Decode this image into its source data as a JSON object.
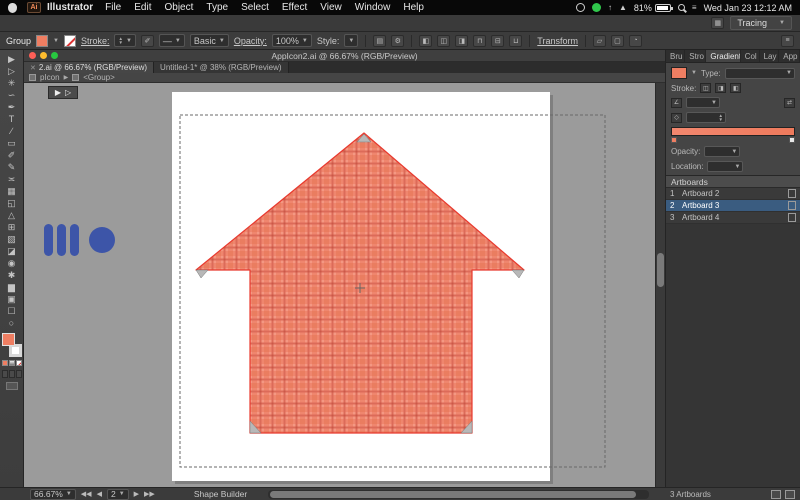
{
  "menubar": {
    "app_name": "Illustrator",
    "items": [
      "File",
      "Edit",
      "Object",
      "Type",
      "Select",
      "Effect",
      "View",
      "Window",
      "Help"
    ],
    "battery": "81%",
    "clock": "Wed Jan 23 12:12 AM"
  },
  "appbar": {
    "workspace": "Tracing"
  },
  "controlbar": {
    "selection_label": "Group",
    "stroke_label": "Stroke:",
    "brush_value": "Basic",
    "opacity_label": "Opacity:",
    "opacity_value": "100%",
    "style_label": "Style:",
    "transform_label": "Transform"
  },
  "window_title": "AppIcon2.ai @ 66.67% (RGB/Preview)",
  "tabs": [
    {
      "label": "2.ai @ 66.67% (RGB/Preview)"
    },
    {
      "label": "Untitled-1* @ 38% (RGB/Preview)"
    }
  ],
  "breadcrumb": {
    "layer": "pIcon",
    "group": "<Group>"
  },
  "tools": [
    {
      "name": "selection",
      "glyph": "▶"
    },
    {
      "name": "direct-selection",
      "glyph": "▷"
    },
    {
      "name": "magic-wand",
      "glyph": "✳"
    },
    {
      "name": "lasso",
      "glyph": "∽"
    },
    {
      "name": "pen",
      "glyph": "✒"
    },
    {
      "name": "type",
      "glyph": "T"
    },
    {
      "name": "line-segment",
      "glyph": "∕"
    },
    {
      "name": "rectangle",
      "glyph": "▭"
    },
    {
      "name": "paintbrush",
      "glyph": "✐"
    },
    {
      "name": "pencil",
      "glyph": "✎"
    },
    {
      "name": "width",
      "glyph": "≍"
    },
    {
      "name": "free-transform",
      "glyph": "▦"
    },
    {
      "name": "shape-builder",
      "glyph": "◱"
    },
    {
      "name": "perspective-grid",
      "glyph": "△"
    },
    {
      "name": "mesh",
      "glyph": "⊞"
    },
    {
      "name": "gradient",
      "glyph": "▧"
    },
    {
      "name": "eyedropper",
      "glyph": "◪"
    },
    {
      "name": "blend",
      "glyph": "◉"
    },
    {
      "name": "symbol-sprayer",
      "glyph": "✱"
    },
    {
      "name": "column-graph",
      "glyph": "▆"
    },
    {
      "name": "artboard",
      "glyph": "▣"
    },
    {
      "name": "hand",
      "glyph": "☐"
    },
    {
      "name": "zoom",
      "glyph": "○"
    }
  ],
  "dock": {
    "panel_tabs": [
      "Bru",
      "Stro",
      "Gradient",
      "Col",
      "Lay",
      "App"
    ],
    "gradient_panel": {
      "type_label": "Type:",
      "stroke_label": "Stroke:",
      "opacity_label": "Opacity:",
      "location_label": "Location:"
    },
    "artboards_panel": {
      "title": "Artboards",
      "rows": [
        {
          "num": "1",
          "name": "Artboard 2"
        },
        {
          "num": "2",
          "name": "Artboard 3"
        },
        {
          "num": "3",
          "name": "Artboard 4"
        }
      ],
      "footer": "3 Artboards"
    }
  },
  "statusbar": {
    "zoom": "66.67%",
    "artboard_current": "2",
    "tool_label": "Shape Builder"
  },
  "colors": {
    "salmon": "#EF7E62",
    "plaid_line": "#DA6350",
    "selection_red": "#E8392E",
    "blue_shape": "#3D55A8",
    "row_highlight": "#3A5C80"
  }
}
